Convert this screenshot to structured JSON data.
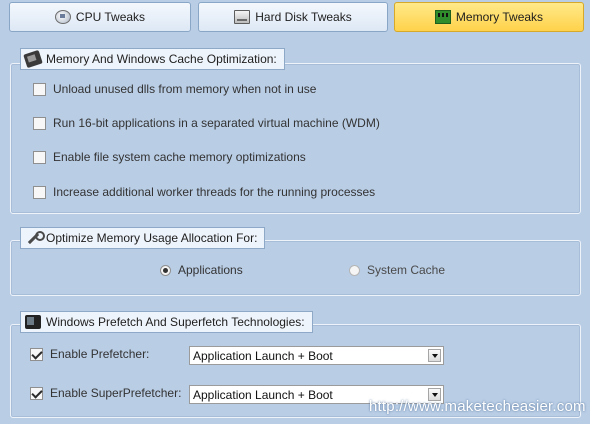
{
  "tabs": [
    {
      "label": "CPU Tweaks",
      "icon": "cpu-icon",
      "active": false
    },
    {
      "label": "Hard Disk Tweaks",
      "icon": "hard-disk-icon",
      "active": false
    },
    {
      "label": "Memory Tweaks",
      "icon": "memory-icon",
      "active": true
    }
  ],
  "cache_group": {
    "title": "Memory And Windows Cache Optimization:",
    "icon": "chip-icon",
    "options": [
      {
        "label": "Unload unused dlls from memory when not in use",
        "checked": false
      },
      {
        "label": "Run 16-bit applications in a separated virtual machine (WDM)",
        "checked": false
      },
      {
        "label": "Enable file system cache memory optimizations",
        "checked": false
      },
      {
        "label": "Increase additional worker threads for the running processes",
        "checked": false
      }
    ]
  },
  "allocation_group": {
    "title": "Optimize Memory Usage Allocation For:",
    "icon": "wrench-icon",
    "options": [
      {
        "label": "Applications",
        "selected": true
      },
      {
        "label": "System Cache",
        "selected": false
      }
    ]
  },
  "prefetch_group": {
    "title": "Windows Prefetch And Superfetch Technologies:",
    "icon": "device-icon",
    "rows": [
      {
        "label": "Enable Prefetcher:",
        "checked": true,
        "value": "Application Launch + Boot"
      },
      {
        "label": "Enable SuperPrefetcher:",
        "checked": true,
        "value": "Application Launch + Boot"
      }
    ]
  },
  "watermark": "http://www.maketecheasier.com",
  "colors": {
    "background": "#b9cde5",
    "active_tab": "#ffd24a",
    "tab": "#e6eef8"
  }
}
